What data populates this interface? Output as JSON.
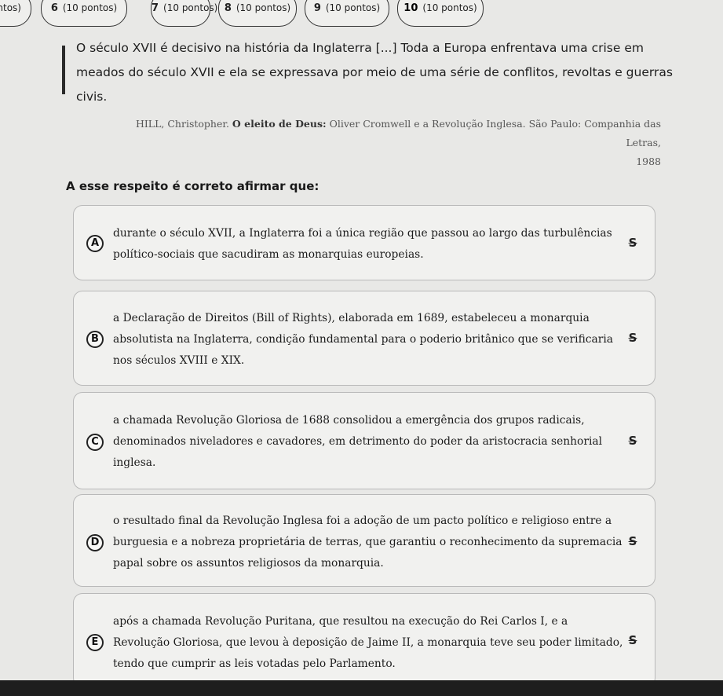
{
  "tabs": [
    {
      "num": "",
      "label": "ntos)"
    },
    {
      "num": "6",
      "label": "(10 pontos)"
    },
    {
      "num": "7",
      "label": "(10 pontos)"
    },
    {
      "num": "8",
      "label": "(10 pontos)"
    },
    {
      "num": "9",
      "label": "(10 pontos)"
    },
    {
      "num": "10",
      "label": "(10 pontos)"
    }
  ],
  "quote": "O século XVII é decisivo na história da Inglaterra [...] Toda a Europa enfrentava uma crise em meados do século XVII e ela se expressava por meio de uma série de conflitos, revoltas e guerras civis.",
  "citation": {
    "author": "HILL, Christopher.",
    "title": "O eleito de Deus:",
    "rest": "Oliver Cromwell e a Revolução Inglesa. São Paulo: Companhia das Letras,",
    "year": "1988"
  },
  "stem": "A esse respeito é correto afirmar que:",
  "options": [
    {
      "letter": "A",
      "text": "durante o século XVII, a Inglaterra foi a única região que passou ao largo das turbulências político-sociais que sacudiram as monarquias europeias."
    },
    {
      "letter": "B",
      "text": "a Declaração de Direitos (Bill of Rights), elaborada em 1689, estabeleceu a monarquia absolutista na Inglaterra, condição fundamental para o poderio britânico que se verificaria nos séculos XVIII e XIX."
    },
    {
      "letter": "C",
      "text": "a chamada Revolução Gloriosa de 1688 consolidou a emergência dos grupos radicais, denominados niveladores e cavadores, em detrimento do poder da aristocracia senhorial inglesa."
    },
    {
      "letter": "D",
      "text": "o resultado final da Revolução Inglesa foi a adoção de um pacto político e religioso entre a burguesia e a nobreza proprietária de terras, que garantiu o reconhecimento da supremacia papal sobre os assuntos religiosos da monarquia."
    },
    {
      "letter": "E",
      "text": "após a chamada Revolução Puritana, que resultou na execução do Rei Carlos I, e a Revolução Gloriosa, que levou à deposição de Jaime II, a monarquia teve seu poder limitado, tendo que cumprir as leis votadas pelo Parlamento."
    }
  ],
  "strike_symbol": "S"
}
